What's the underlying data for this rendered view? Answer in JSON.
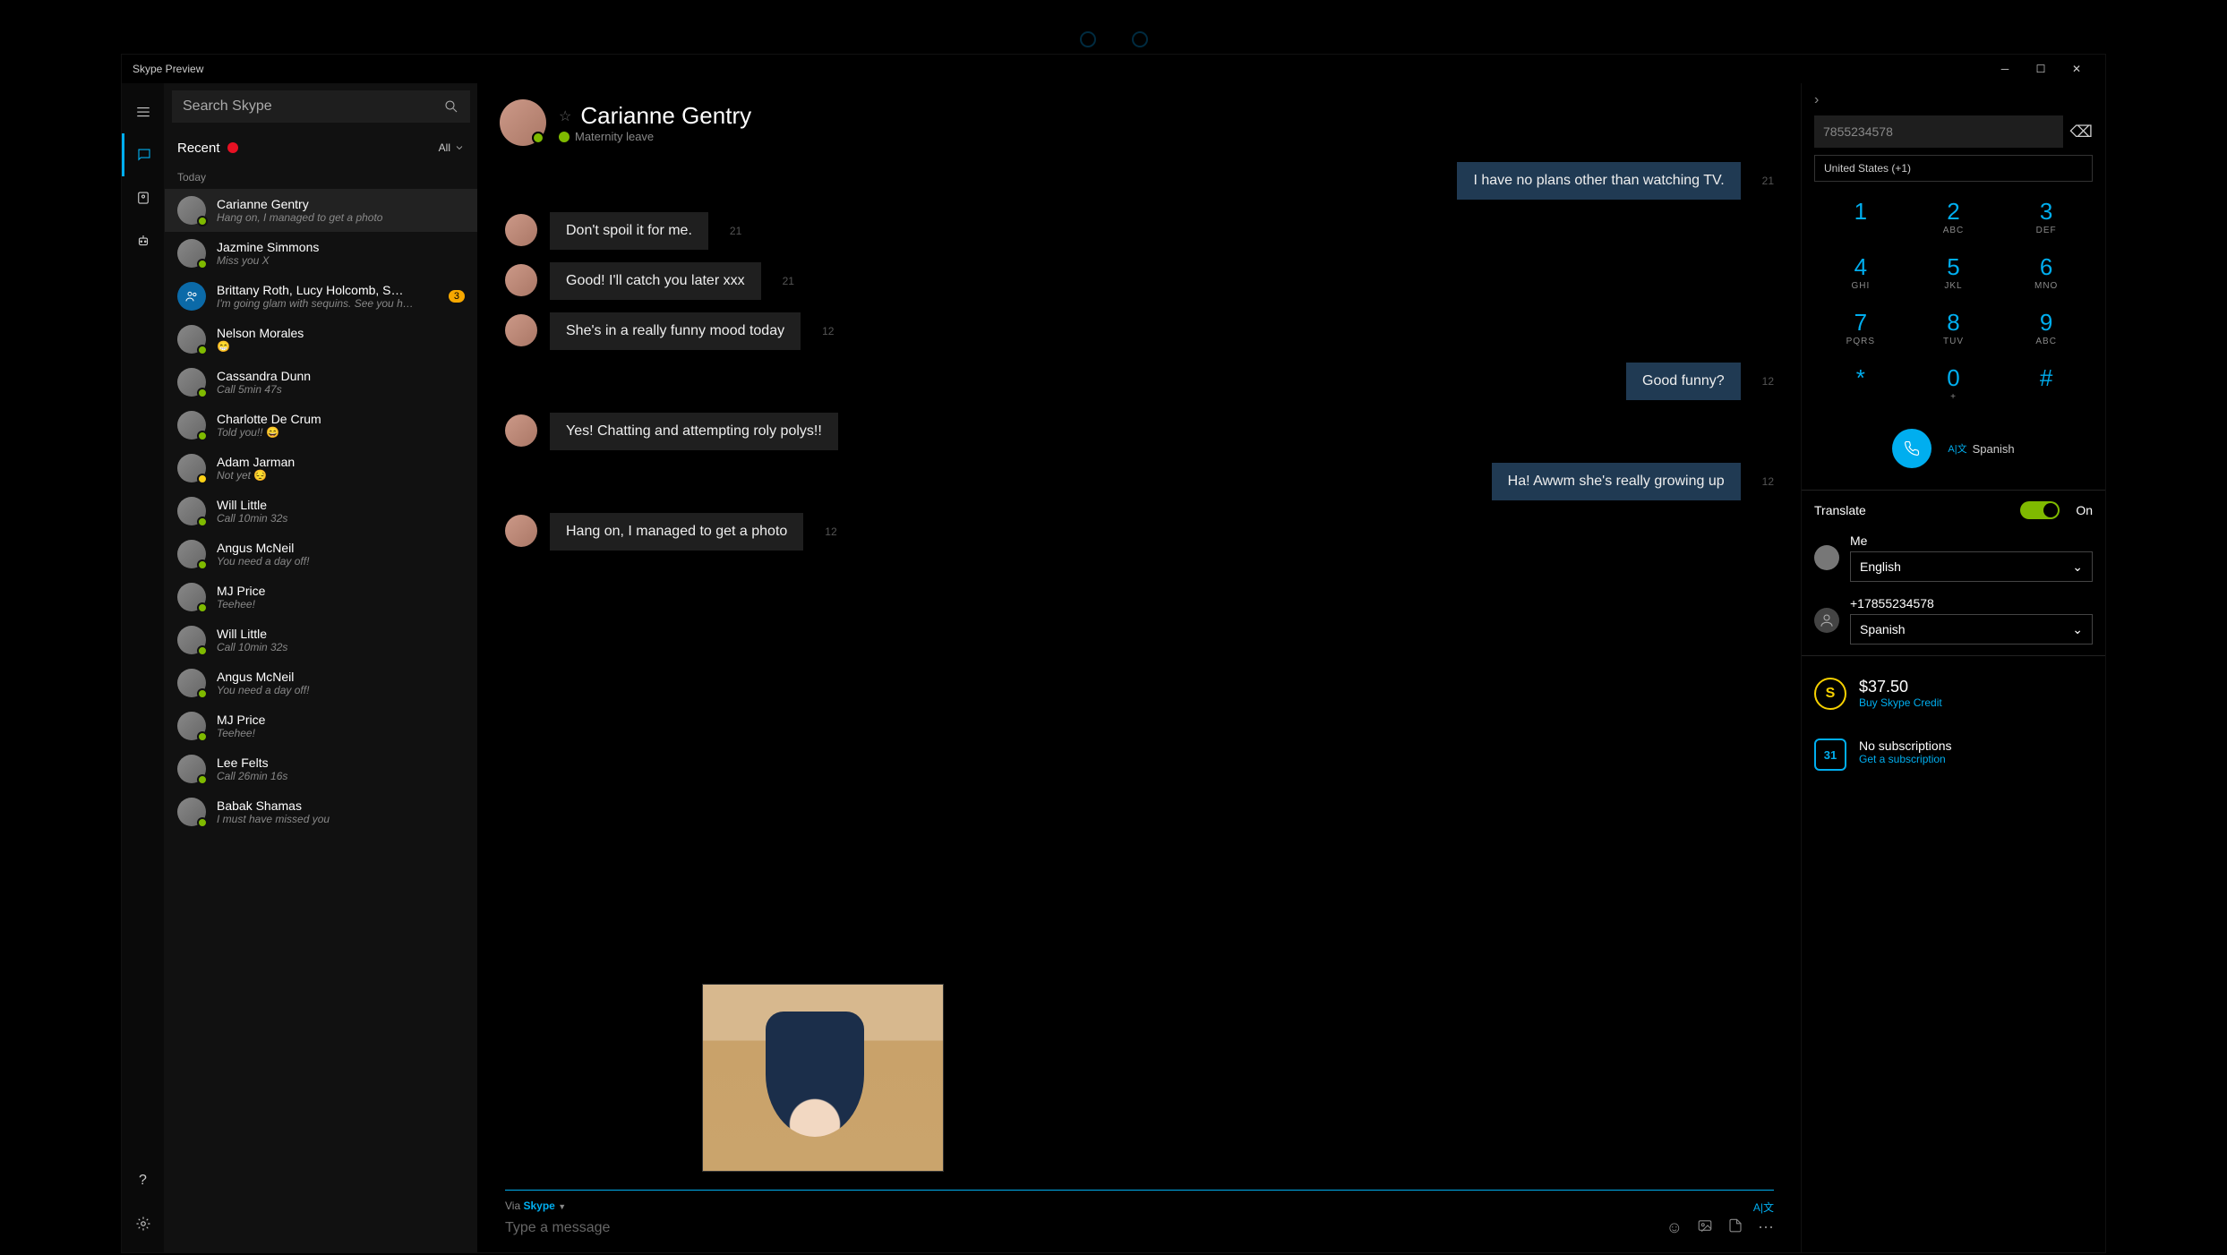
{
  "window_title": "Skype Preview",
  "search": {
    "placeholder": "Search Skype"
  },
  "section": {
    "label": "Recent",
    "filter": "All",
    "day": "Today"
  },
  "contacts": [
    {
      "name": "Carianne Gentry",
      "sub": "Hang on, I managed to get a photo",
      "presence": "online",
      "active": true
    },
    {
      "name": "Jazmine Simmons",
      "sub": "Miss you X",
      "presence": "online"
    },
    {
      "name": "Brittany Roth, Lucy Holcomb, S…",
      "sub": "I'm going glam with sequins. See you h…",
      "group": true,
      "badge": "3"
    },
    {
      "name": "Nelson Morales",
      "sub_emoji": "😁",
      "presence": "online"
    },
    {
      "name": "Cassandra Dunn",
      "sub": "Call 5min 47s",
      "presence": "online"
    },
    {
      "name": "Charlotte De Crum",
      "sub": "Told you!!",
      "emoji": "😄",
      "presence": "online"
    },
    {
      "name": "Adam Jarman",
      "sub": "Not yet",
      "emoji": "😔",
      "presence": "away"
    },
    {
      "name": "Will Little",
      "sub": "Call 10min 32s",
      "presence": "online"
    },
    {
      "name": "Angus McNeil",
      "sub": "You need a day off!",
      "presence": "online"
    },
    {
      "name": "MJ Price",
      "sub": "Teehee!",
      "presence": "online"
    },
    {
      "name": "Will Little",
      "sub": "Call 10min 32s",
      "presence": "online"
    },
    {
      "name": "Angus McNeil",
      "sub": "You need a day off!",
      "presence": "online"
    },
    {
      "name": "MJ Price",
      "sub": "Teehee!",
      "presence": "online"
    },
    {
      "name": "Lee Felts",
      "sub": "Call 26min 16s",
      "presence": "online"
    },
    {
      "name": "Babak Shamas",
      "sub": "I must have missed you",
      "presence": "online"
    }
  ],
  "chat": {
    "name": "Carianne Gentry",
    "status": "Maternity leave",
    "via_label": "Via",
    "via_value": "Skype",
    "compose_placeholder": "Type a message",
    "messages": [
      {
        "mine": true,
        "text": "I have no plans other than watching TV.",
        "ts": "21"
      },
      {
        "mine": false,
        "text": "Don't spoil it for me.",
        "ts": "21"
      },
      {
        "mine": false,
        "text": "Good! I'll catch you later xxx",
        "ts": "21"
      },
      {
        "mine": false,
        "text": "She's in a really funny mood today",
        "ts": "12"
      },
      {
        "mine": true,
        "text": "Good funny?",
        "ts": "12"
      },
      {
        "mine": false,
        "text": "Yes! Chatting and attempting roly polys!!",
        "ts": ""
      },
      {
        "mine": true,
        "text": "Ha! Awwm she's really growing up",
        "ts": "12"
      },
      {
        "mine": false,
        "text": "Hang on, I managed to get a photo",
        "ts": "12"
      }
    ]
  },
  "dialer": {
    "number": "7855234578",
    "country": "United States (+1)",
    "keys": [
      {
        "n": "1",
        "l": ""
      },
      {
        "n": "2",
        "l": "ABC"
      },
      {
        "n": "3",
        "l": "DEF"
      },
      {
        "n": "4",
        "l": "GHI"
      },
      {
        "n": "5",
        "l": "JKL"
      },
      {
        "n": "6",
        "l": "MNO"
      },
      {
        "n": "7",
        "l": "PQRS"
      },
      {
        "n": "8",
        "l": "TUV"
      },
      {
        "n": "9",
        "l": "ABC"
      },
      {
        "n": "*",
        "l": ""
      },
      {
        "n": "0",
        "l": "+"
      },
      {
        "n": "#",
        "l": ""
      }
    ],
    "call_lang": "Spanish"
  },
  "translate": {
    "label": "Translate",
    "on": "On",
    "me_label": "Me",
    "me_lang": "English",
    "them_label": "+17855234578",
    "them_lang": "Spanish"
  },
  "credit": {
    "amount": "$37.50",
    "buy": "Buy Skype Credit",
    "sub_none": "No subscriptions",
    "sub_get": "Get a subscription",
    "cal": "31"
  }
}
